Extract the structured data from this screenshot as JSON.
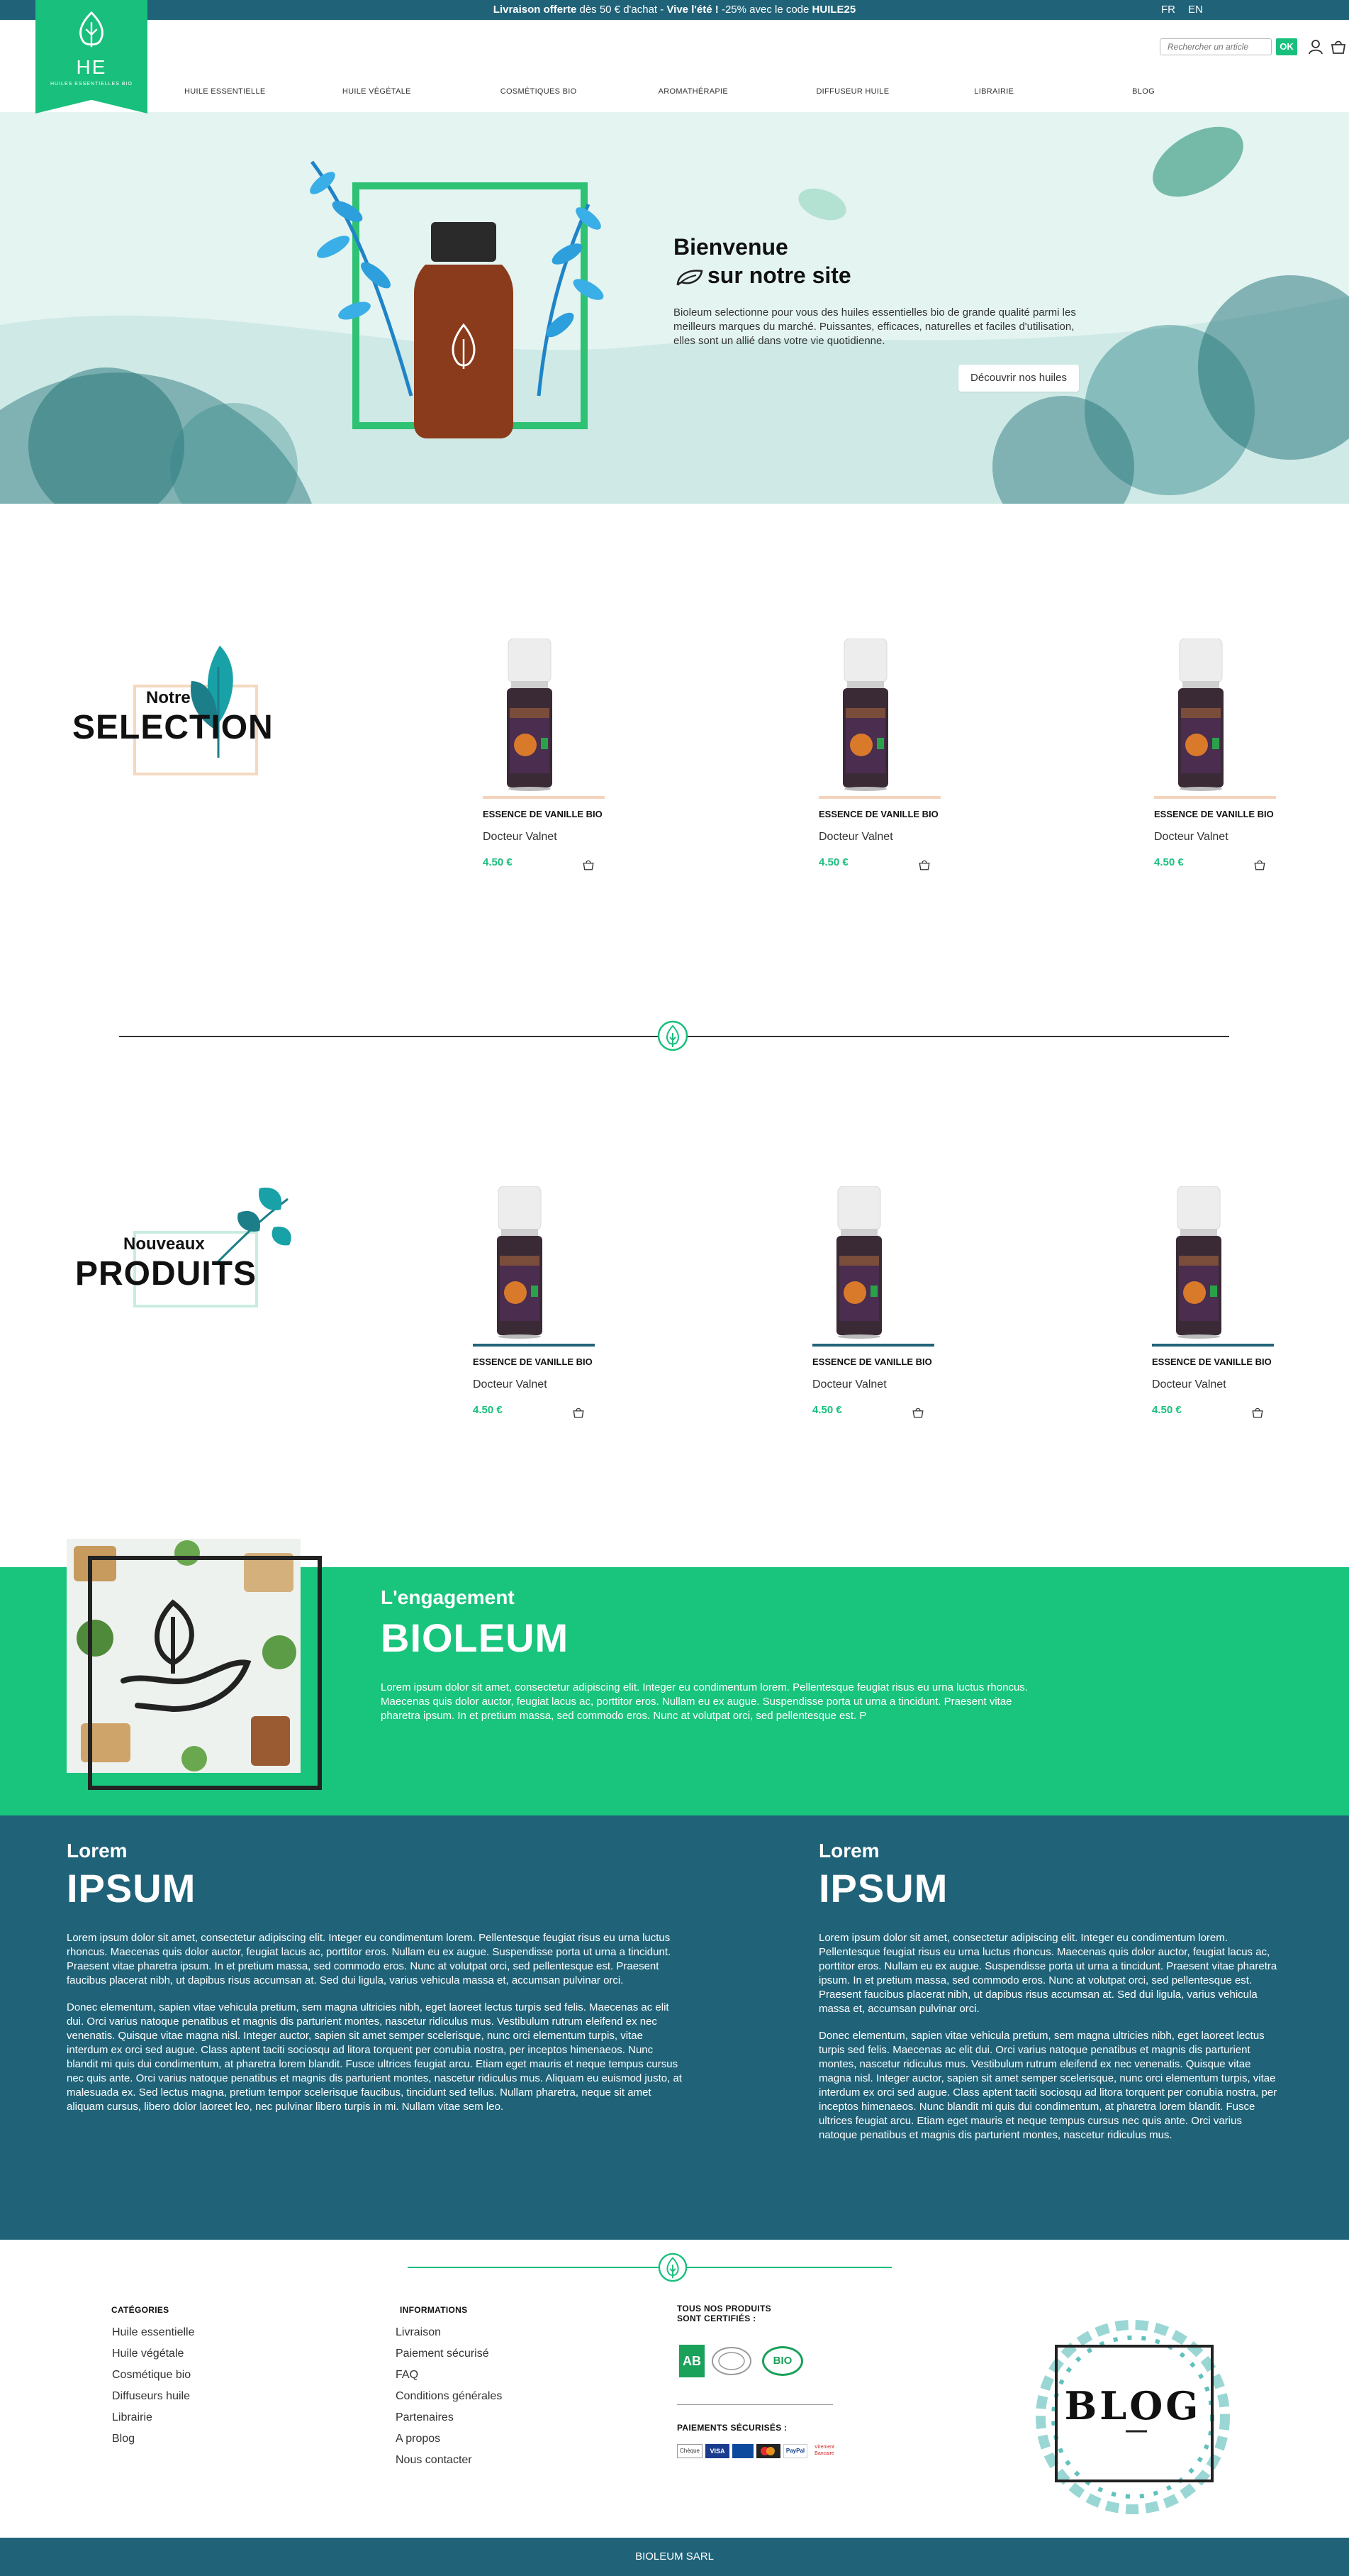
{
  "topbar": {
    "promo_a": "Livraison offerte",
    "promo_b": " dès 50 € d'achat - ",
    "promo_c": "Vive l'été !",
    "promo_d": " -25% avec le code ",
    "promo_e": "HUILE25",
    "lang_fr": "FR",
    "lang_en": "EN"
  },
  "logo": {
    "letters": "HE",
    "tagline": "HUILES ESSENTIELLES BIO"
  },
  "search": {
    "placeholder": "Rechercher un article",
    "button": "OK"
  },
  "nav": [
    "HUILE ESSENTIELLE",
    "HUILE VÉGÉTALE",
    "COSMÉTIQUES BIO",
    "AROMATHÉRAPIE",
    "DIFFUSEUR HUILE",
    "LIBRAIRIE",
    "BLOG"
  ],
  "hero": {
    "line1": "Bienvenue",
    "line2": "sur notre site",
    "intro": "Bioleum selectionne pour vous des huiles essentielles bio de grande qualité parmi les meilleurs marques du marché. Puissantes, efficaces, naturelles et faciles d'utilisation, elles sont un allié dans votre vie quotidienne.",
    "cta": "Découvrir nos huiles"
  },
  "selection": {
    "small": "Notre",
    "big": "SELECTION",
    "products": [
      {
        "name": "ESSENCE DE VANILLE BIO",
        "brand": "Docteur Valnet",
        "price": "4.50 €"
      },
      {
        "name": "ESSENCE DE VANILLE BIO",
        "brand": "Docteur Valnet",
        "price": "4.50 €"
      },
      {
        "name": "ESSENCE DE VANILLE BIO",
        "brand": "Docteur Valnet",
        "price": "4.50 €"
      }
    ]
  },
  "nouveaux": {
    "small": "Nouveaux",
    "big": "PRODUITS",
    "products": [
      {
        "name": "ESSENCE DE VANILLE BIO",
        "brand": "Docteur Valnet",
        "price": "4.50 €"
      },
      {
        "name": "ESSENCE DE VANILLE BIO",
        "brand": "Docteur Valnet",
        "price": "4.50 €"
      },
      {
        "name": "ESSENCE DE VANILLE BIO",
        "brand": "Docteur Valnet",
        "price": "4.50 €"
      }
    ]
  },
  "engagement": {
    "small": "L'engagement",
    "big": "BIOLEUM",
    "text": "Lorem ipsum dolor sit amet, consectetur adipiscing elit. Integer eu condimentum lorem. Pellentesque feugiat risus eu urna luctus rhoncus. Maecenas quis dolor auctor, feugiat lacus ac, porttitor eros. Nullam eu ex augue. Suspendisse porta ut urna a tincidunt. Praesent vitae pharetra ipsum. In et pretium massa, sed commodo eros. Nunc at volutpat orci, sed pellentesque est. P"
  },
  "lorem": {
    "left": {
      "small": "Lorem",
      "big": "IPSUM",
      "p1": "Lorem ipsum dolor sit amet, consectetur adipiscing elit. Integer eu condimentum lorem. Pellentesque feugiat risus eu urna luctus rhoncus. Maecenas quis dolor auctor, feugiat lacus ac, porttitor eros. Nullam eu ex augue. Suspendisse porta ut urna a tincidunt. Praesent vitae pharetra ipsum. In et pretium massa, sed commodo eros. Nunc at volutpat orci, sed pellentesque est. Praesent faucibus placerat nibh, ut dapibus risus accumsan at. Sed dui ligula, varius vehicula massa et, accumsan pulvinar orci.",
      "p2": "Donec elementum, sapien vitae vehicula pretium, sem magna ultricies nibh, eget laoreet lectus turpis sed felis. Maecenas ac elit dui. Orci varius natoque penatibus et magnis dis parturient montes, nascetur ridiculus mus. Vestibulum rutrum eleifend ex nec venenatis. Quisque vitae magna nisl. Integer auctor, sapien sit amet semper scelerisque, nunc orci elementum turpis, vitae interdum ex orci sed augue. Class aptent taciti sociosqu ad litora torquent per conubia nostra, per inceptos himenaeos. Nunc blandit mi quis dui condimentum, at pharetra lorem blandit. Fusce ultrices feugiat arcu. Etiam eget mauris et neque tempus cursus nec quis ante. Orci varius natoque penatibus et magnis dis parturient montes, nascetur ridiculus mus. Aliquam eu euismod justo, at malesuada ex. Sed lectus magna, pretium tempor scelerisque faucibus, tincidunt sed tellus. Nullam pharetra, neque sit amet aliquam cursus, libero dolor laoreet leo, nec pulvinar libero turpis in mi. Nullam vitae sem leo."
    },
    "right": {
      "small": "Lorem",
      "big": "IPSUM",
      "p1": "Lorem ipsum dolor sit amet, consectetur adipiscing elit. Integer eu condimentum lorem. Pellentesque feugiat risus eu urna luctus rhoncus. Maecenas quis dolor auctor, feugiat lacus ac, porttitor eros. Nullam eu ex augue. Suspendisse porta ut urna a tincidunt. Praesent vitae pharetra ipsum. In et pretium massa, sed commodo eros. Nunc at volutpat orci, sed pellentesque est. Praesent faucibus placerat nibh, ut dapibus risus accumsan at. Sed dui ligula, varius vehicula massa et, accumsan pulvinar orci.",
      "p2": "Donec elementum, sapien vitae vehicula pretium, sem magna ultricies nibh, eget laoreet lectus turpis sed felis. Maecenas ac elit dui. Orci varius natoque penatibus et magnis dis parturient montes, nascetur ridiculus mus. Vestibulum rutrum eleifend ex nec venenatis. Quisque vitae magna nisl. Integer auctor, sapien sit amet semper scelerisque, nunc orci elementum turpis, vitae interdum ex orci sed augue. Class aptent taciti sociosqu ad litora torquent per conubia nostra, per inceptos himenaeos. Nunc blandit mi quis dui condimentum, at pharetra lorem blandit. Fusce ultrices feugiat arcu. Etiam eget mauris et neque tempus cursus nec quis ante. Orci varius natoque penatibus et magnis dis parturient montes, nascetur ridiculus mus."
    }
  },
  "footer": {
    "categories_title": "CATÉGORIES",
    "categories": [
      "Huile essentielle",
      "Huile végétale",
      "Cosmétique bio",
      "Diffuseurs huile",
      "Librairie",
      "Blog"
    ],
    "info_title": "INFORMATIONS",
    "info": [
      "Livraison",
      "Paiement sécurisé",
      "FAQ",
      "Conditions générales",
      "Partenaires",
      "A propos",
      "Nous contacter"
    ],
    "cert_title_1": "TOUS NOS PRODUITS",
    "cert_title_2": "SONT CERTIFIÉS :",
    "cert_ab": "AB",
    "cert_bio": "BIO",
    "pay_title": "PAIEMENTS SÉCURISÉS :",
    "payments": [
      "Chèque",
      "VISA",
      "",
      "",
      "PayPal",
      "Virement Bancaire"
    ],
    "blog": "BLOG"
  },
  "bottom": "BIOLEUM SARL",
  "colors": {
    "green": "#19bf7c",
    "teal": "#206379",
    "mint": "#e4f4f1"
  }
}
